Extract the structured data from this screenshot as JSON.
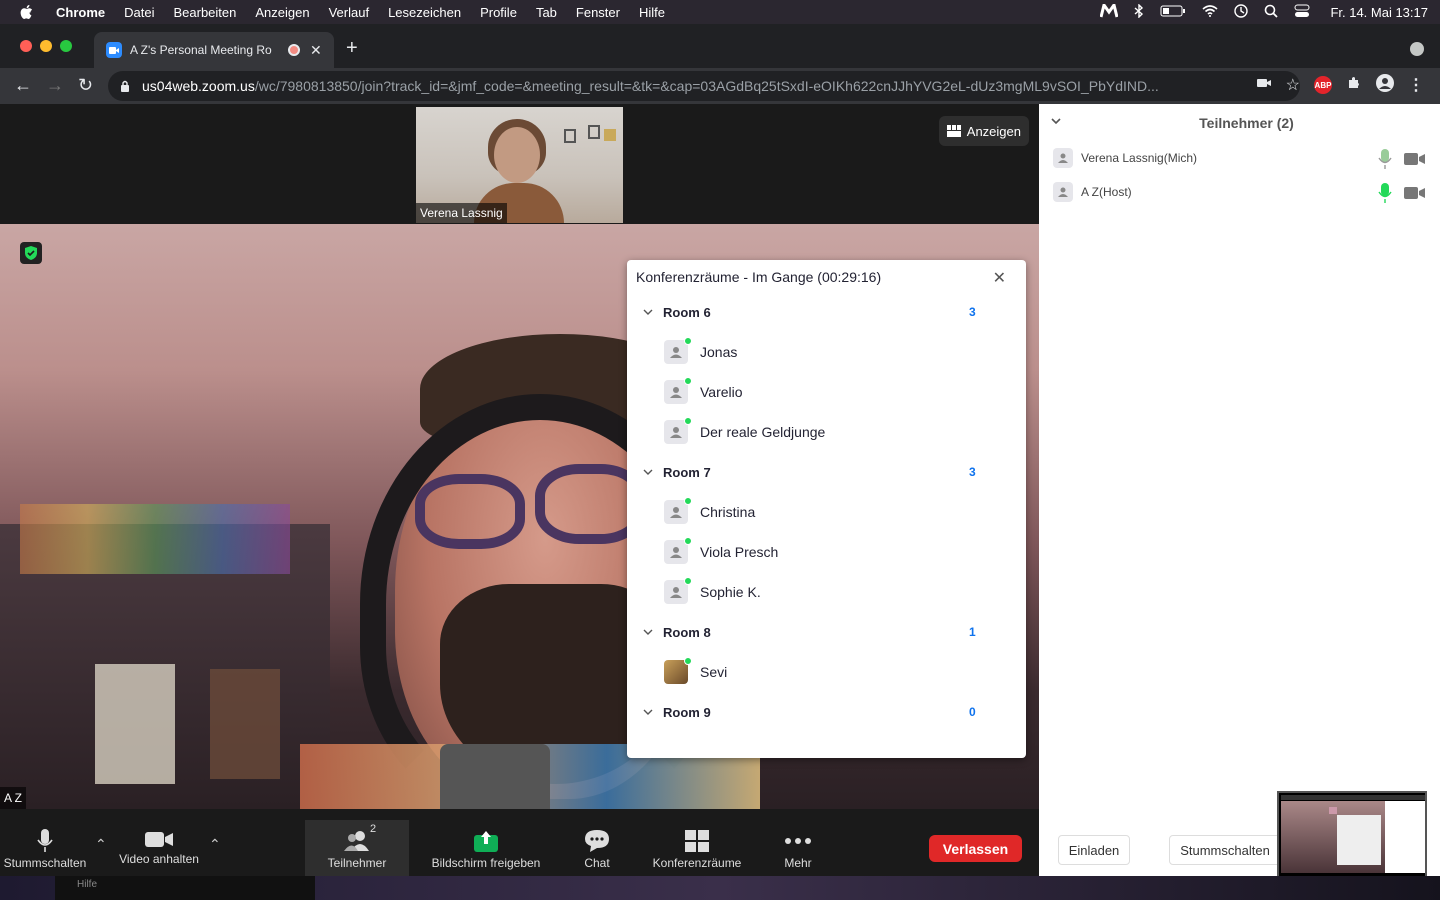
{
  "menubar": {
    "app": "Chrome",
    "items": [
      "Datei",
      "Bearbeiten",
      "Anzeigen",
      "Verlauf",
      "Lesezeichen",
      "Profile",
      "Tab",
      "Fenster",
      "Hilfe"
    ],
    "clock": "Fr. 14. Mai  13:17"
  },
  "browser": {
    "tab_title": "A Z's Personal Meeting Ro",
    "url_domain": "us04web.zoom.us",
    "url_path": "/wc/7980813850/join?track_id=&jmf_code=&meeting_result=&tk=&cap=03AGdBq25tSxdI-eOIKh622cnJJhYVG2eL-dUz3mgML9vSOI_PbYdIND...",
    "abp_badge": "ABP"
  },
  "video": {
    "thumb_name": "Verena Lassnig",
    "view_button": "Anzeigen",
    "main_name": "A Z"
  },
  "breakout": {
    "title": "Konferenzräume - Im Gange (00:29:16)",
    "rooms": [
      {
        "name": "Room 6",
        "count": "3",
        "members": [
          "Jonas",
          "Varelio",
          "Der reale Geldjunge"
        ]
      },
      {
        "name": "Room 7",
        "count": "3",
        "members": [
          "Christina",
          "Viola Presch",
          "Sophie K."
        ]
      },
      {
        "name": "Room 8",
        "count": "1",
        "members": [
          "Sevi"
        ]
      },
      {
        "name": "Room 9",
        "count": "0",
        "members": []
      }
    ]
  },
  "controls": {
    "mute": "Stummschalten",
    "video": "Video anhalten",
    "participants": "Teilnehmer",
    "participants_count": "2",
    "share": "Bildschirm freigeben",
    "chat": "Chat",
    "breakout": "Konferenzräume",
    "more": "Mehr",
    "leave": "Verlassen"
  },
  "participants_panel": {
    "title": "Teilnehmer (2)",
    "people": [
      {
        "name": "Verena Lassnig(Mich)"
      },
      {
        "name": "A Z(Host)"
      }
    ],
    "invite": "Einladen",
    "mute_all": "Stummschalten"
  },
  "dock": {
    "label": "Hilfe"
  },
  "colors": {
    "zoom_blue": "#0e72ed",
    "leave_red": "#e02828",
    "online_green": "#23d959",
    "share_green": "#0fae56"
  }
}
